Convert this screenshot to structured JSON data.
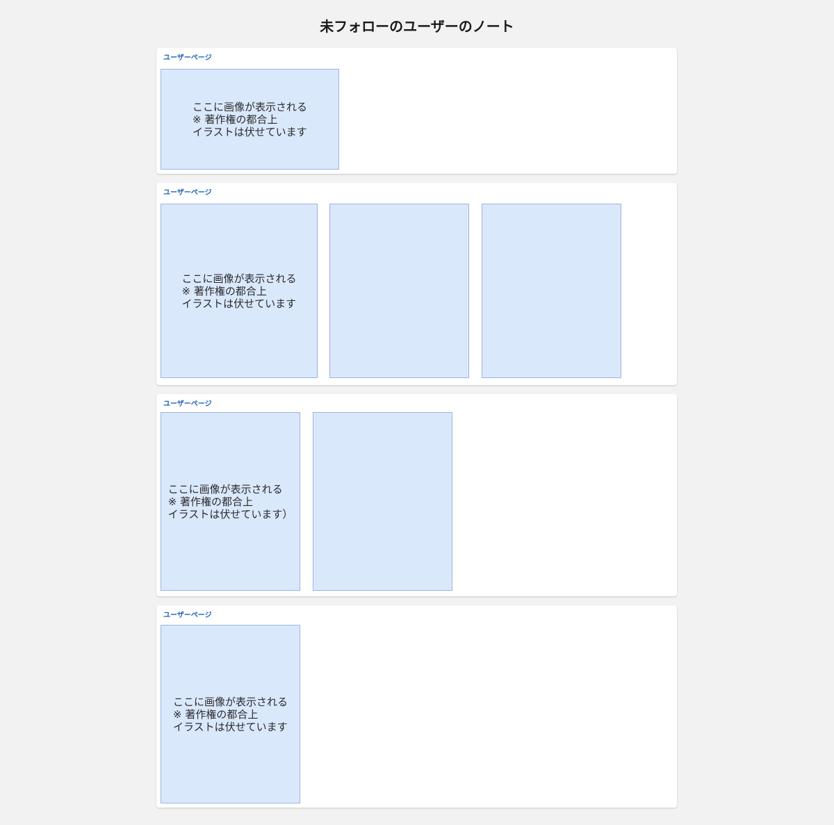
{
  "page": {
    "title": "未フォローのユーザーのノート"
  },
  "colors": {
    "background": "#f2f2f2",
    "card": "#ffffff",
    "link": "#1e63b4",
    "thumb_fill": "#dae8fc",
    "thumb_border": "#9db3dc"
  },
  "notes": [
    {
      "user_link": "ユーザーページ",
      "images": [
        {
          "placeholder": "ここに画像が表示される\n※ 著作権の都合上\nイラストは伏せています"
        }
      ]
    },
    {
      "user_link": "ユーザーページ",
      "images": [
        {
          "placeholder": "ここに画像が表示される\n※ 著作権の都合上\nイラストは伏せています"
        },
        {
          "placeholder": ""
        },
        {
          "placeholder": ""
        }
      ]
    },
    {
      "user_link": "ユーザーページ",
      "images": [
        {
          "placeholder": "ここに画像が表示される\n※ 著作権の都合上\nイラストは伏せています）"
        },
        {
          "placeholder": ""
        }
      ]
    },
    {
      "user_link": "ユーザーページ",
      "images": [
        {
          "placeholder": "ここに画像が表示される\n※ 著作権の都合上\nイラストは伏せています"
        }
      ]
    }
  ]
}
